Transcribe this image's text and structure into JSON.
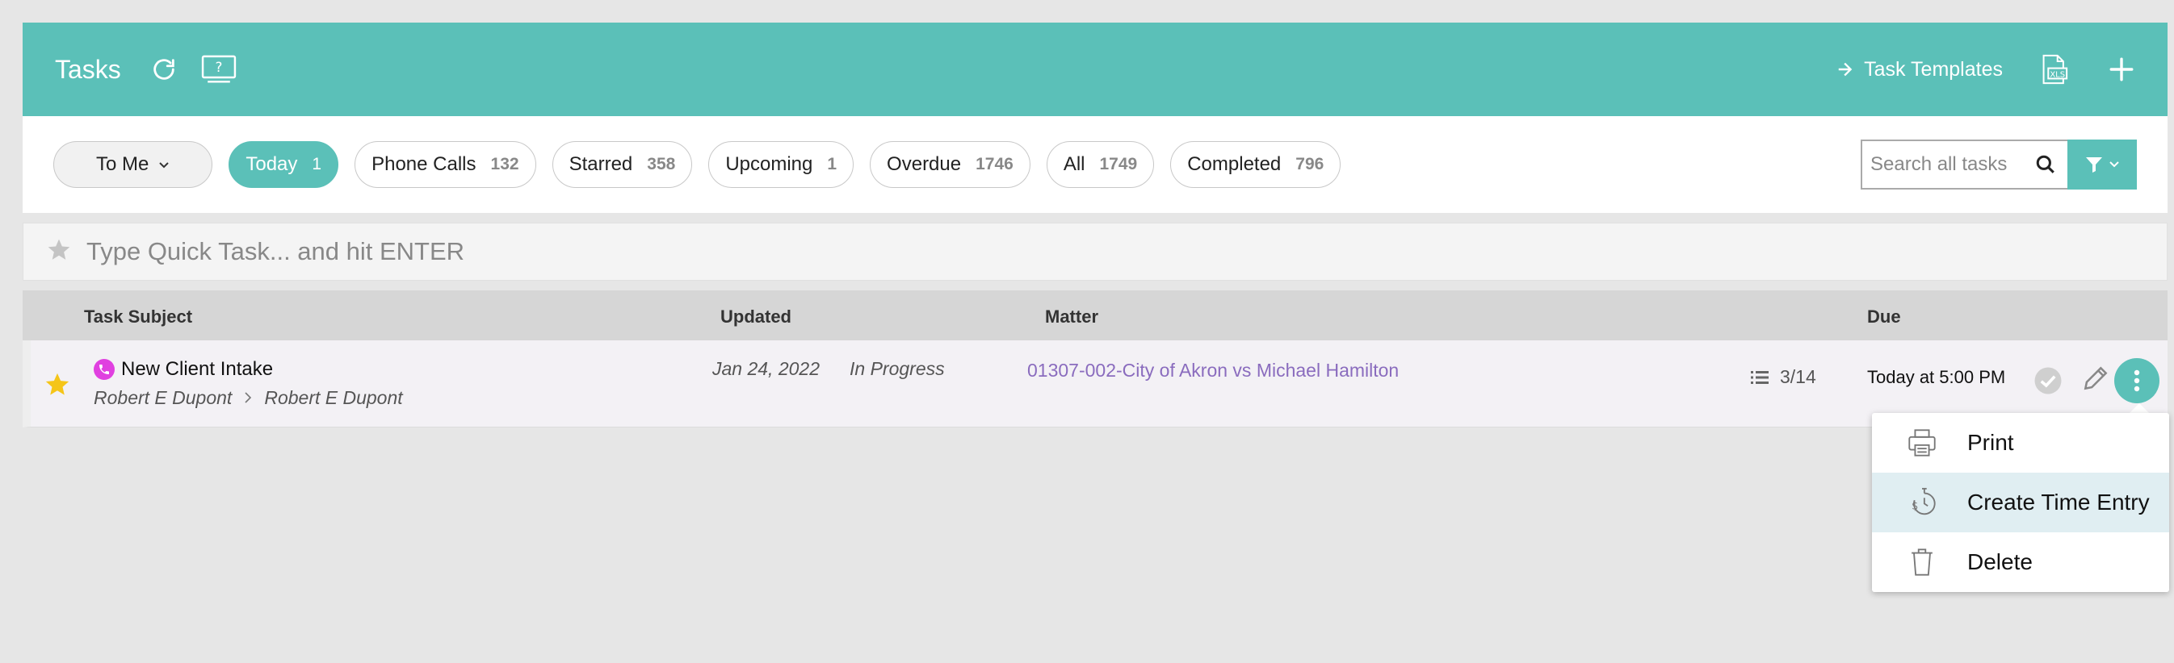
{
  "header": {
    "title": "Tasks",
    "task_templates_label": "Task Templates"
  },
  "filters": {
    "assignee": "To Me",
    "pills": [
      {
        "label": "Today",
        "count": "1",
        "active": true
      },
      {
        "label": "Phone Calls",
        "count": "132"
      },
      {
        "label": "Starred",
        "count": "358"
      },
      {
        "label": "Upcoming",
        "count": "1"
      },
      {
        "label": "Overdue",
        "count": "1746"
      },
      {
        "label": "All",
        "count": "1749"
      },
      {
        "label": "Completed",
        "count": "796"
      }
    ],
    "search_placeholder": "Search all tasks"
  },
  "quick_task": {
    "placeholder": "Type Quick Task... and hit ENTER"
  },
  "table": {
    "columns": {
      "subject": "Task Subject",
      "updated": "Updated",
      "matter": "Matter",
      "due": "Due"
    },
    "rows": [
      {
        "subject": "New Client Intake",
        "assigned_by": "Robert E Dupont",
        "assigned_to": "Robert E Dupont",
        "updated": "Jan 24, 2022",
        "status": "In Progress",
        "matter": "01307-002-City of Akron vs Michael Hamilton",
        "checklist": "3/14",
        "due": "Today at 5:00 PM"
      }
    ]
  },
  "menu": {
    "items": [
      {
        "label": "Print",
        "icon": "printer-icon"
      },
      {
        "label": "Create Time Entry",
        "icon": "stopwatch-dollar-icon",
        "highlighted": true
      },
      {
        "label": "Delete",
        "icon": "trash-icon"
      }
    ]
  },
  "colors": {
    "accent": "#5bc0b8",
    "matter_link": "#8a6cbe",
    "star": "#f5c518",
    "phone_badge": "#e040e0",
    "menu_highlight": "#e0eef2"
  }
}
